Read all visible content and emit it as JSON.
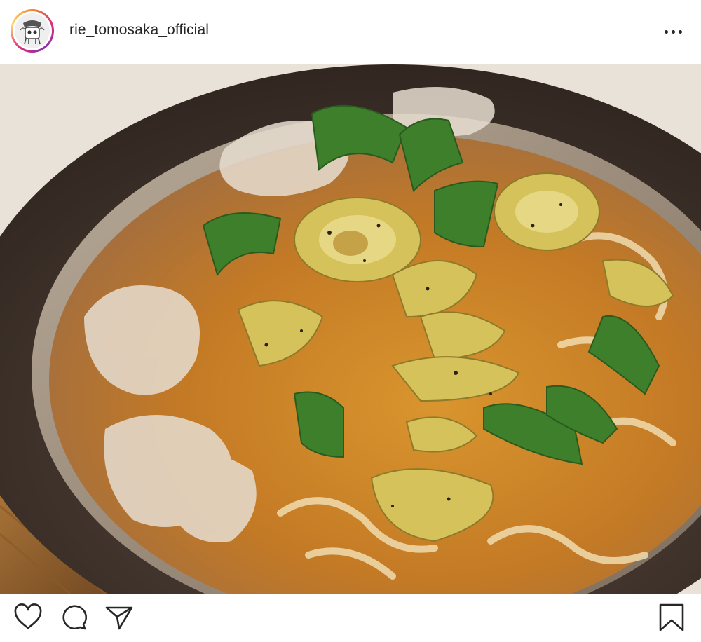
{
  "post": {
    "username": "rie_tomosaka_official",
    "image_alt": "ramen with leeks"
  },
  "icons": {
    "avatar": "avatar-illustration-icon",
    "more": "more-options-icon",
    "like": "heart-icon",
    "comment": "comment-bubble-icon",
    "share": "paper-plane-icon",
    "save": "bookmark-icon"
  },
  "colors": {
    "text": "#262626",
    "story_ring_start": "#f58529",
    "story_ring_end": "#8134af",
    "broth": "#c98a3a",
    "bowl": "#3a2e28",
    "leek_green": "#3f8a2c",
    "leek_pale": "#d8c760"
  }
}
